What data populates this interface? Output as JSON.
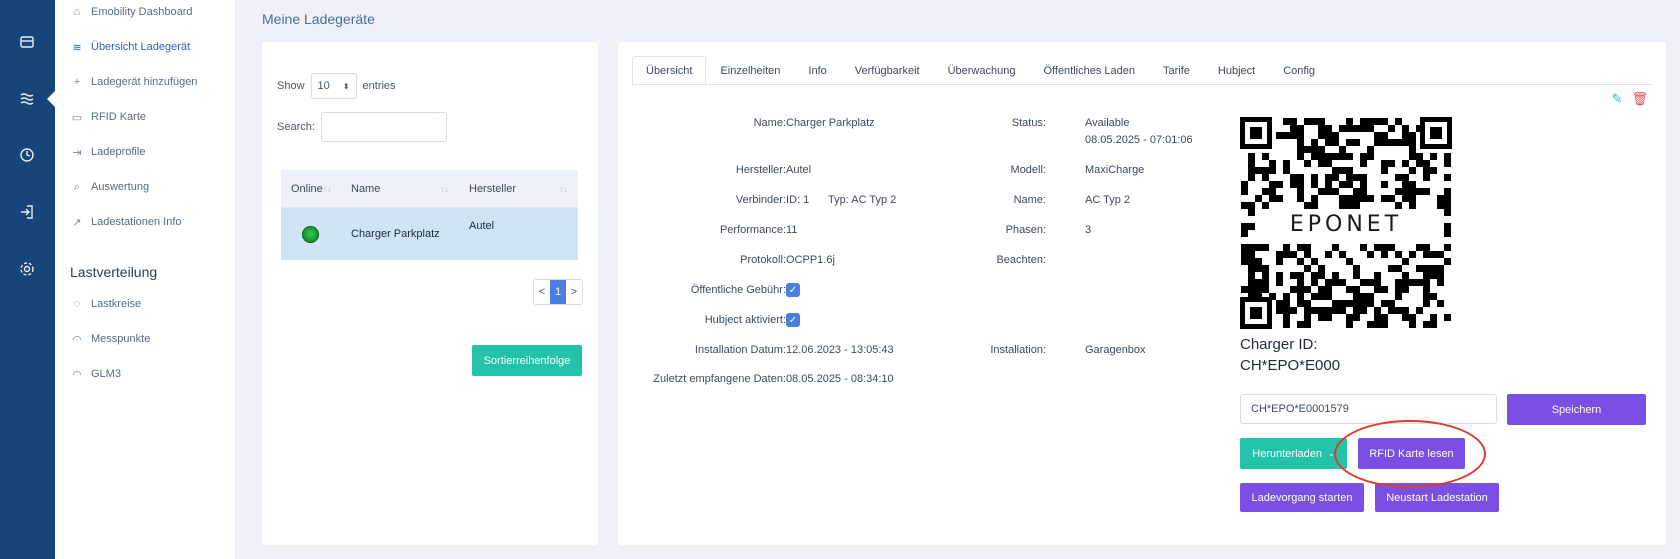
{
  "rail": {
    "icons": [
      "store-icon",
      "list-icon",
      "clock-icon",
      "login-icon",
      "settings-icon"
    ]
  },
  "sidebar": {
    "items": [
      {
        "label": "Emobility Dashboard",
        "icon": "home-icon"
      },
      {
        "label": "Übersicht Ladegerät",
        "icon": "waves-icon",
        "active": true
      },
      {
        "label": "Ladegerät hinzufügen",
        "icon": "plus-icon"
      },
      {
        "label": "RFID Karte",
        "icon": "card-icon"
      },
      {
        "label": "Ladeprofile",
        "icon": "login-icon"
      },
      {
        "label": "Auswertung",
        "icon": "search-icon"
      },
      {
        "label": "Ladestationen Info",
        "icon": "chart-icon"
      }
    ],
    "section_heading": "Lastverteilung",
    "section_items": [
      {
        "label": "Lastkreise",
        "icon": "circle-icon"
      },
      {
        "label": "Messpunkte",
        "icon": "gauge-icon"
      },
      {
        "label": "GLM3",
        "icon": "gauge-icon"
      }
    ]
  },
  "page": {
    "title": "Meine Ladegeräte"
  },
  "list": {
    "show_label": "Show",
    "entries_value": "10",
    "entries_label": "entries",
    "search_label": "Search:",
    "columns": [
      "Online",
      "Name",
      "Hersteller"
    ],
    "rows": [
      {
        "online": "online",
        "name": "Charger Parkplatz",
        "manufacturer": "Autel"
      }
    ],
    "pager": {
      "prev": "<",
      "current": "1",
      "next": ">"
    },
    "sort_button": "Sortierreihenfolge"
  },
  "detail": {
    "tabs": [
      "Übersicht",
      "Einzelheiten",
      "Info",
      "Verfügbarkeit",
      "Überwachung",
      "Öffentliches Laden",
      "Tarife",
      "Hubject",
      "Config"
    ],
    "active_tab": "Übersicht",
    "fields_left": {
      "name_label": "Name:",
      "name_value": "Charger Parkplatz",
      "hersteller_label": "Hersteller:",
      "hersteller_value": "Autel",
      "verbinder_label": "Verbinder:",
      "verbinder_id": "ID: 1",
      "verbinder_typ": "Typ: AC Typ 2",
      "performance_label": "Performance:",
      "performance_value": "11",
      "protokoll_label": "Protokoll:",
      "protokoll_value": "OCPP1.6j",
      "gebuehr_label": "Öffentliche Gebühr:",
      "gebuehr_checked": true,
      "hubject_label": "Hubject aktiviert:",
      "hubject_checked": true,
      "installation_datum_label": "Installation Datum:",
      "installation_datum_value": "12.06.2023 - 13:05:43",
      "zuletzt_label": "Zuletzt empfangene Daten:",
      "zuletzt_value": "08.05.2025 - 08:34:10"
    },
    "fields_right": {
      "status_label": "Status:",
      "status_value": "Available",
      "status_time": "08.05.2025 - 07:01:06",
      "modell_label": "Modell:",
      "modell_value": "MaxiCharge",
      "name_label": "Name:",
      "name_value": "AC Typ 2",
      "phasen_label": "Phasen:",
      "phasen_value": "3",
      "beachten_label": "Beachten:",
      "beachten_value": "",
      "installation_label": "Installation:",
      "installation_value": "Garagenbox"
    },
    "qr_brand": "EPONET",
    "charger_id_label": "Charger ID:",
    "charger_id_value": "CH*EPO*E000",
    "charger_id_input": "CH*EPO*E0001579",
    "buttons": {
      "speichern": "Speichern",
      "herunterladen": "Herunterladen",
      "rfid_lesen": "RFID Karte lesen",
      "ladevorgang": "Ladevorgang starten",
      "neustart": "Neustart Ladestation"
    },
    "highlight_color": "#e03a2a"
  }
}
